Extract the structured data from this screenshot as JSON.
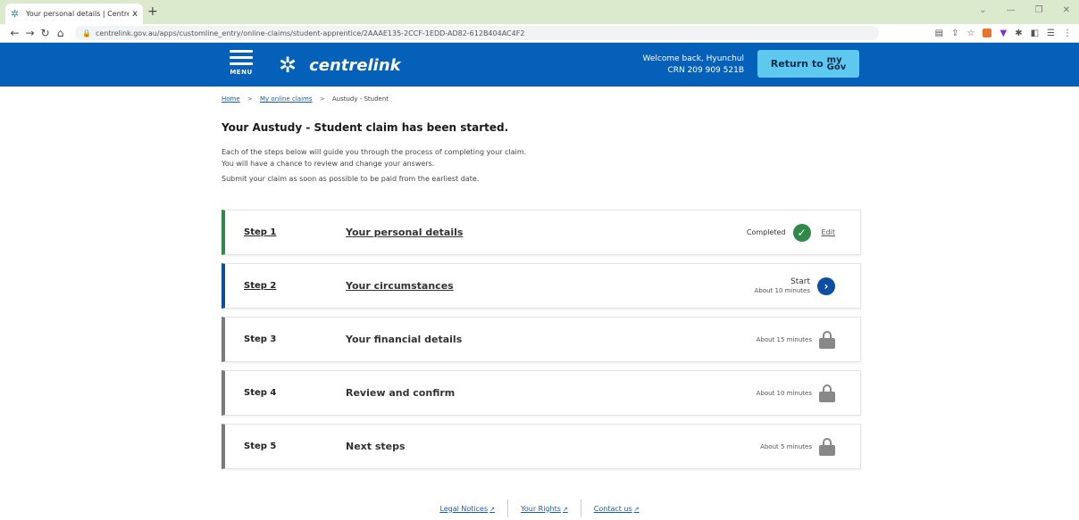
{
  "browser": {
    "tab_title": "Your personal details | Centrelin",
    "url": "centrelink.gov.au/apps/customline_entry/online-claims/student-apprentice/2AAAE135-2CCF-1EDD-AD82-612B404AC4F2",
    "new_tab_symbol": "+",
    "tab_close_symbol": "x"
  },
  "header": {
    "menu_label": "MENU",
    "brand": "centrelink",
    "welcome_line": "Welcome back, Hyunchul",
    "crn_line": "CRN 209 909 521B",
    "return_label": "Return to",
    "mygov_top": "my",
    "mygov_bottom": "Gov",
    "header_color": "#0460b8",
    "button_color": "#5ec8ef"
  },
  "breadcrumb": {
    "home": "Home",
    "claims": "My online claims",
    "current": "Austudy - Student",
    "sep": ">"
  },
  "page": {
    "title": "Your Austudy - Student claim has been started.",
    "intro_line1": "Each of the steps below will guide you through the process of completing your claim.",
    "intro_line2": "You will have a chance to review and change your answers.",
    "intro_line3": "Submit your claim as soon as possible to be paid from the earliest date."
  },
  "steps": [
    {
      "number": "Step 1",
      "name": "Your personal details",
      "status": "Completed",
      "action": "Edit",
      "color": "#2f8a4a"
    },
    {
      "number": "Step 2",
      "name": "Your circumstances",
      "status": "Start",
      "time": "About 10 minutes",
      "color": "#0b4ea2"
    },
    {
      "number": "Step 3",
      "name": "Your financial details",
      "time": "About 15 minutes"
    },
    {
      "number": "Step 4",
      "name": "Review and confirm",
      "time": "About 10 minutes"
    },
    {
      "number": "Step 5",
      "name": "Next steps",
      "time": "About 5 minutes"
    }
  ],
  "footer": {
    "legal": "Legal Notices",
    "rights": "Your Rights",
    "contact": "Contact us"
  }
}
